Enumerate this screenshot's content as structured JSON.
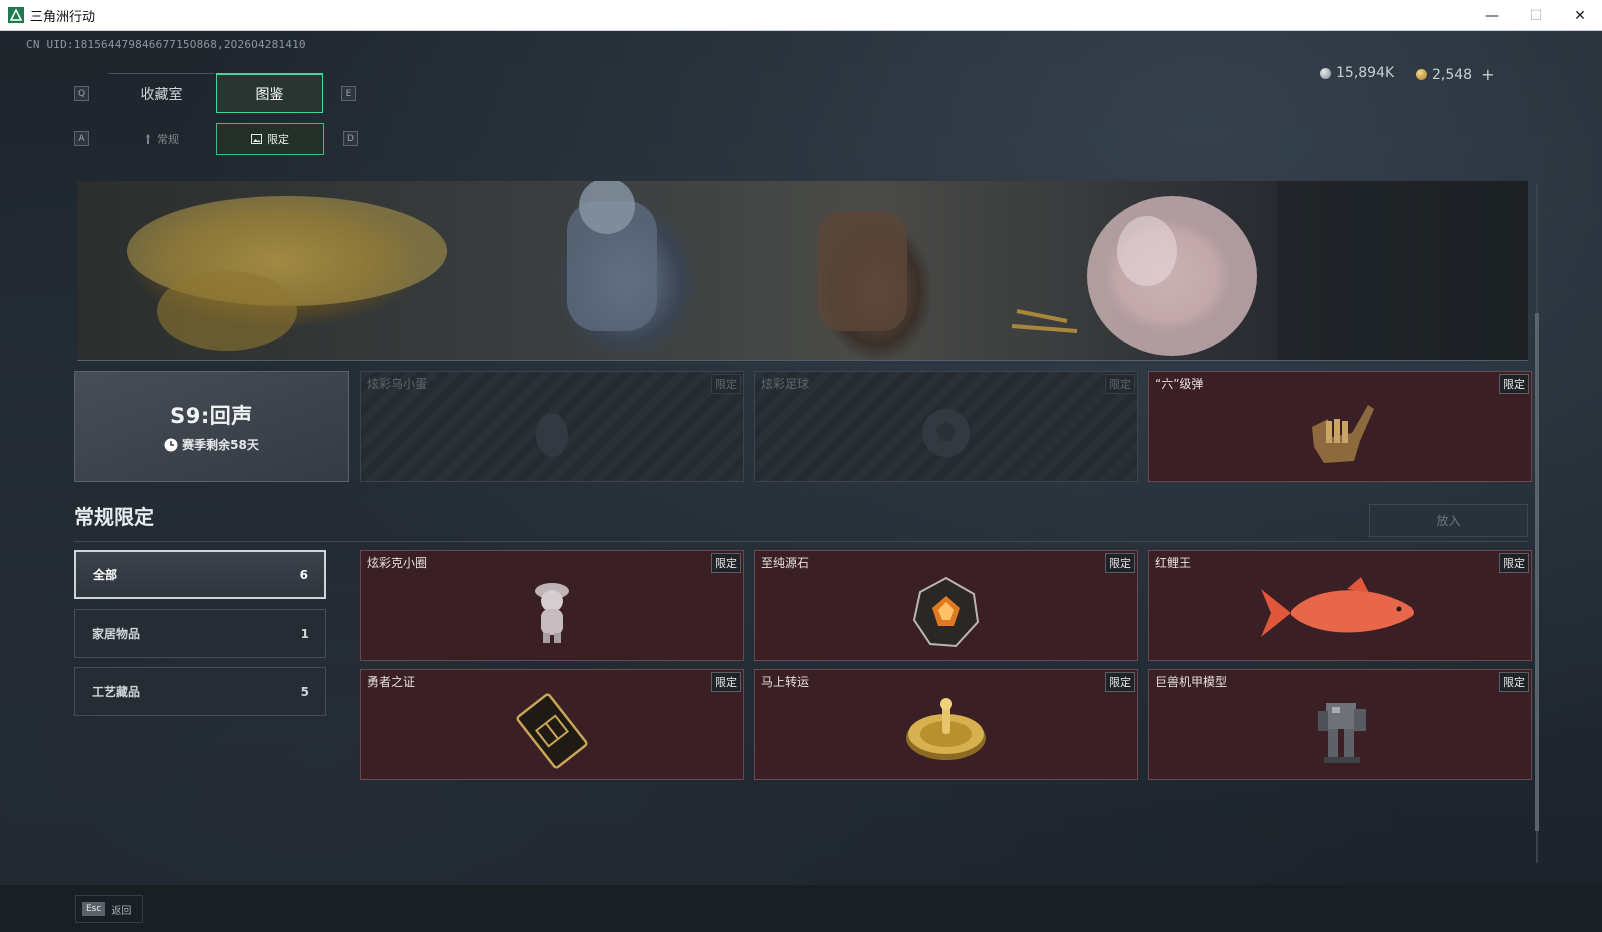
{
  "window": {
    "title": "三角洲行动",
    "minimize": "—",
    "maximize": "☐",
    "close": "✕"
  },
  "uid": "CN UID:18156447984667715O868,2O26O4281410",
  "keys": {
    "prev_tab": "Q",
    "next_tab": "E",
    "prev_sub": "A",
    "next_sub": "D"
  },
  "tabs": [
    {
      "label": "收藏室",
      "active": false
    },
    {
      "label": "图鉴",
      "active": true
    }
  ],
  "subtabs": [
    {
      "label": "常规",
      "icon": "torch-icon",
      "active": false
    },
    {
      "label": "限定",
      "icon": "picture-icon",
      "active": true
    }
  ],
  "currency": {
    "silver": "15,894K",
    "gold": "2,548",
    "add": "+"
  },
  "season": {
    "title": "S9:回声",
    "remaining": "赛季剩余58天"
  },
  "featured_items": [
    {
      "name": "炫彩乌小蛋",
      "tag": "限定",
      "locked": true
    },
    {
      "name": "炫彩足球",
      "tag": "限定",
      "locked": true
    },
    {
      "name": "“六”级弹",
      "tag": "限定",
      "locked": false,
      "art": "bullet-hand"
    }
  ],
  "section": {
    "title": "常规限定",
    "place_button": "放入"
  },
  "filters": [
    {
      "label": "全部",
      "count": "6",
      "active": true
    },
    {
      "label": "家居物品",
      "count": "1",
      "active": false
    },
    {
      "label": "工艺藏品",
      "count": "5",
      "active": false
    }
  ],
  "items": [
    {
      "name": "炫彩克小圈",
      "tag": "限定",
      "art": "figurine"
    },
    {
      "name": "至纯源石",
      "tag": "限定",
      "art": "gem"
    },
    {
      "name": "红鲤王",
      "tag": "限定",
      "art": "fish"
    },
    {
      "name": "勇者之证",
      "tag": "限定",
      "art": "card"
    },
    {
      "name": "马上转运",
      "tag": "限定",
      "art": "wheel"
    },
    {
      "name": "巨兽机甲模型",
      "tag": "限定",
      "art": "mech"
    }
  ],
  "footer": {
    "esc_key": "Esc",
    "esc_label": "返回"
  },
  "colors": {
    "accent": "#48d49a",
    "card_bg": "#3a1f24",
    "card_border": "#6a4a50"
  }
}
